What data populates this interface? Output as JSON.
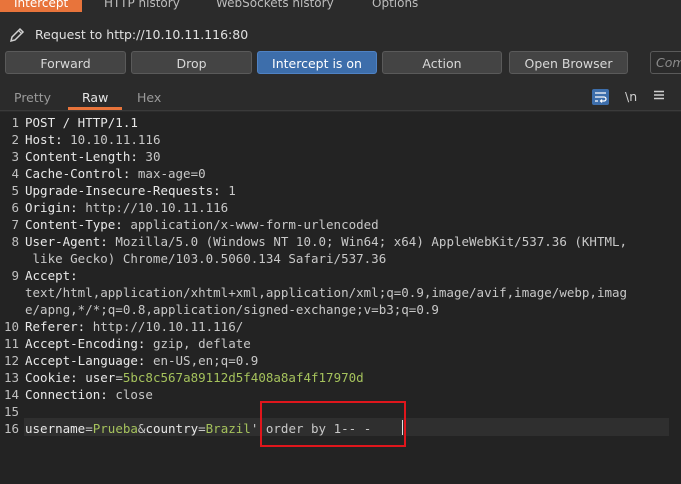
{
  "top_tabs": [
    "Intercept",
    "HTTP history",
    "WebSockets history",
    "Options"
  ],
  "request_label": "Request to http://10.10.11.116:80",
  "buttons": {
    "forward": "Forward",
    "drop": "Drop",
    "intercept": "Intercept is on",
    "action": "Action",
    "open_browser": "Open Browser"
  },
  "comment_placeholder": "Comment this item",
  "view_tabs": [
    "Pretty",
    "Raw",
    "Hex"
  ],
  "newline_toggle": "\\n",
  "lines": [
    {
      "n": "1",
      "parts": [
        [
          "POST / HTTP/1.1",
          "key"
        ]
      ]
    },
    {
      "n": "2",
      "parts": [
        [
          "Host: ",
          "key"
        ],
        [
          "10.10.11.116",
          "val"
        ]
      ]
    },
    {
      "n": "3",
      "parts": [
        [
          "Content-Length: ",
          "key"
        ],
        [
          "30",
          "val"
        ]
      ]
    },
    {
      "n": "4",
      "parts": [
        [
          "Cache-Control: ",
          "key"
        ],
        [
          "max-age=0",
          "val"
        ]
      ]
    },
    {
      "n": "5",
      "parts": [
        [
          "Upgrade-Insecure-Requests: ",
          "key"
        ],
        [
          "1",
          "val"
        ]
      ]
    },
    {
      "n": "6",
      "parts": [
        [
          "Origin: ",
          "key"
        ],
        [
          "http://10.10.11.116",
          "val"
        ]
      ]
    },
    {
      "n": "7",
      "parts": [
        [
          "Content-Type: ",
          "key"
        ],
        [
          "application/x-www-form-urlencoded",
          "val"
        ]
      ]
    },
    {
      "n": "8",
      "parts": [
        [
          "User-Agent: ",
          "key"
        ],
        [
          "Mozilla/5.0 (Windows NT 10.0; Win64; x64) AppleWebKit/537.36 (KHTML,",
          "val"
        ]
      ],
      "cont": [
        " like Gecko) Chrome/103.0.5060.134 Safari/537.36"
      ]
    },
    {
      "n": "9",
      "parts": [
        [
          "Accept:",
          "key"
        ]
      ],
      "cont": [
        "text/html,application/xhtml+xml,application/xml;q=0.9,image/avif,image/webp,imag",
        "e/apng,*/*;q=0.8,application/signed-exchange;v=b3;q=0.9"
      ]
    },
    {
      "n": "10",
      "parts": [
        [
          "Referer: ",
          "key"
        ],
        [
          "http://10.10.11.116/",
          "val"
        ]
      ]
    },
    {
      "n": "11",
      "parts": [
        [
          "Accept-Encoding: ",
          "key"
        ],
        [
          "gzip, deflate",
          "val"
        ]
      ]
    },
    {
      "n": "12",
      "parts": [
        [
          "Accept-Language: ",
          "key"
        ],
        [
          "en-US,en;q=0.9",
          "val"
        ]
      ]
    },
    {
      "n": "13",
      "parts": [
        [
          "Cookie: ",
          "key"
        ],
        [
          "user",
          "key"
        ],
        [
          "=",
          "val"
        ],
        [
          "5bc8c567a89112d5f408a8af4f17970d",
          "green"
        ]
      ]
    },
    {
      "n": "14",
      "parts": [
        [
          "Connection: ",
          "key"
        ],
        [
          "close",
          "val"
        ]
      ]
    },
    {
      "n": "15",
      "parts": []
    },
    {
      "n": "16",
      "parts": [
        [
          "username",
          "key"
        ],
        [
          "=",
          "val"
        ],
        [
          "Prueba",
          "green"
        ],
        [
          "&",
          "val"
        ],
        [
          "country",
          "key"
        ],
        [
          "=",
          "val"
        ],
        [
          "Brazil",
          "green"
        ],
        [
          "' order by 1-- -",
          "val"
        ]
      ]
    }
  ],
  "colors": {
    "accent": "#e8743b",
    "intercept_on": "#3d6eab",
    "highlight_box": "#e0161c",
    "value_green": "#a5c25c"
  }
}
